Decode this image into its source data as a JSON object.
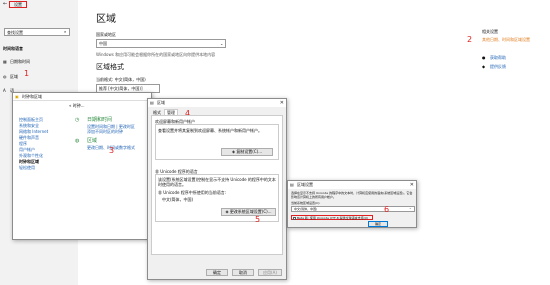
{
  "settings": {
    "back_arrow": "←",
    "app_title": "设置",
    "search_placeholder": "查找设置",
    "nav_group": "时间和语言",
    "nav_items": [
      {
        "label": "日期和时间"
      },
      {
        "label": "区域"
      },
      {
        "label": "语"
      }
    ],
    "page_title": "区域",
    "country_label": "国家或地区",
    "country_value": "中国",
    "country_desc": "Windows 和应用可能会根据你所在的国家或地区向你提供本地内容",
    "format_title": "区域格式",
    "format_label": "当前格式: 中文(简体，中国)",
    "format_value": "推荐 [中文(简体，中国)]",
    "related_title": "相关设置",
    "related_link": "其他日期、时间和区域设置",
    "help_link": "获取帮助",
    "feedback_link": "提供反馈"
  },
  "control_panel": {
    "title": "时钟和区域",
    "breadcrumb": "« 时钟...",
    "side_links": [
      "控制面板主页",
      "系统和安全",
      "网络和 Internet",
      "硬件和声音",
      "程序",
      "用户帐户",
      "外观和个性化",
      "时钟和区域",
      "轻松使用"
    ],
    "date_heading": "日期和时间",
    "date_sub": "设置时间和日期 | 更改时区\n添加不同时区的时钟",
    "region_heading": "区域",
    "region_sub": "更改日期、时间或数字格式"
  },
  "region_dialog": {
    "title": "区域",
    "tabs": [
      "格式",
      "管理"
    ],
    "group1_title": "欢迎屏幕和新用户帐户",
    "group1_desc": "查看设置并将其复制到欢迎屏幕、系统帐户和新用户帐户。",
    "copy_button": "复制设置(C)...",
    "group2_title": "非 Unicode 程序的语言",
    "group2_desc": "该设置(系统区域设置)控制在显示不支持 Unicode 的程序中的文本时使用的语言。",
    "current_label": "非 Unicode 程序中所使用的当前语言:",
    "current_value": "中文(简体，中国)",
    "change_button": "更改系统区域设置(C)...",
    "ok": "确定",
    "cancel": "取消",
    "apply": "应用(A)"
  },
  "locale_dialog": {
    "title": "区域设置",
    "desc": "选择在显示不支持 Unicode 的程序中的文本时，计算机应使用的语言(系统区域设置)。它会影响该计算机上的所有用户帐户。",
    "locale_label": "当前系统区域设置(C):",
    "locale_value": "中文(简体，中国)",
    "beta_label": "Beta 版: 使用 Unicode UTF-8 提供全球语言支持(U)",
    "ok": "确定"
  },
  "markers": [
    "1",
    "2",
    "3",
    "4",
    "5",
    "6"
  ]
}
